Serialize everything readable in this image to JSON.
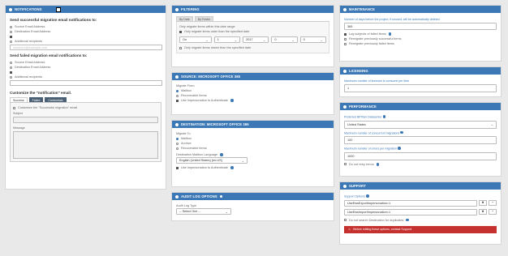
{
  "notifications": {
    "title": "NOTIFICATIONS",
    "success_heading": "Send successful migration email notifications to:",
    "failed_heading": "Send failed migration email notifications to:",
    "recipients": [
      "Source Email Address",
      "Destination Email Address",
      "Additional recipients"
    ],
    "success_additional_value": "someone@example.com",
    "customize_heading": "Customize the \"notification\" email.",
    "tabs": [
      "Success",
      "Failed",
      "Credentials"
    ],
    "customize_checkbox": "Customize the \"Successful migration\" email",
    "subject_label": "Subject",
    "message_label": "Message"
  },
  "filtering": {
    "title": "FILTERING",
    "tabs": [
      "By Date",
      "By Folder"
    ],
    "date_note": "Only migrate items within this date range",
    "older_check": "Only migrate items older than the specified date",
    "date_parts": [
      "On",
      "1",
      "2017",
      "0",
      "0"
    ],
    "newer_check": "Only migrate items newer than the specified date"
  },
  "source": {
    "title": "SOURCE: MICROSOFT OFFICE 365",
    "migrate_from": "Migrate From",
    "options": [
      "Mailbox",
      "Recoverable Items"
    ],
    "impersonation": "Use Impersonation to Authenticate"
  },
  "destination": {
    "title": "DESTINATION: MICROSOFT OFFICE 365",
    "migrate_to": "Migrate To",
    "options": [
      "Mailbox",
      "Archive",
      "Recoverable Items"
    ],
    "language_label": "Destination Mailbox Language",
    "language_value": "English (United States) [en-US]",
    "impersonation": "Use Impersonation to Authenticate"
  },
  "audit": {
    "title": "AUDIT LOG OPTIONS",
    "label": "Audit Log Type",
    "value": "-- Select One --"
  },
  "maintenance": {
    "title": "MAINTENANCE",
    "days_label": "Number of days before the project, if unused, will be automatically deleted",
    "days_value": "365",
    "checks": [
      "Log subjects of failed items",
      "Remigrate previously successful items",
      "Remigrate previously failed items"
    ]
  },
  "licensing": {
    "title": "LICENSING",
    "label": "Maximum number of licenses to consume per item",
    "value": "1"
  },
  "performance": {
    "title": "PERFORMANCE",
    "location_label": "Preferred BitTitan Datacenter",
    "location_value": "United States",
    "concurrent_label": "Maximum number of concurrent migrations",
    "concurrent_value": "100",
    "errors_label": "Maximum number of errors per migration",
    "errors_value": "1000",
    "noretry": "Do not retry errors"
  },
  "support": {
    "title": "SUPPORT",
    "options_label": "Support Options",
    "options": [
      "UseEwsExportImpersonation=1",
      "UseEwsImportImpersonation=1"
    ],
    "search_check": "Do not search Destination for duplicates",
    "alert": "Before editing these options, contact Support."
  }
}
